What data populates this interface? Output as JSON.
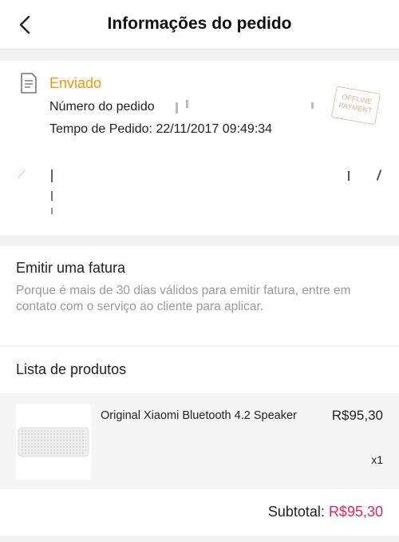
{
  "header": {
    "title": "Informações do pedido",
    "back_icon": "chevron-left-icon"
  },
  "order": {
    "status": "Enviado",
    "number_label": "Número do pedido",
    "time_label": "Tempo de Pedido:",
    "time_value": "22/11/2017 09:49:34",
    "stamp_text_1": "OFFLINE",
    "stamp_text_2": "PAYMENT",
    "status_color": "#f39a0a"
  },
  "invoice": {
    "title": "Emitir uma fatura",
    "description": "Porque é mais de 30 dias válidos para emitir fatura, entre em contato com o serviço ao cliente para aplicar."
  },
  "products": {
    "title": "Lista de produtos",
    "items": [
      {
        "name": "Original Xiaomi Bluetooth 4.2 Speaker",
        "price": "R$95,30",
        "quantity": "x1"
      }
    ]
  },
  "subtotal": {
    "label": "Subtotal:",
    "value": "R$95,30",
    "value_color": "#e8245e"
  }
}
